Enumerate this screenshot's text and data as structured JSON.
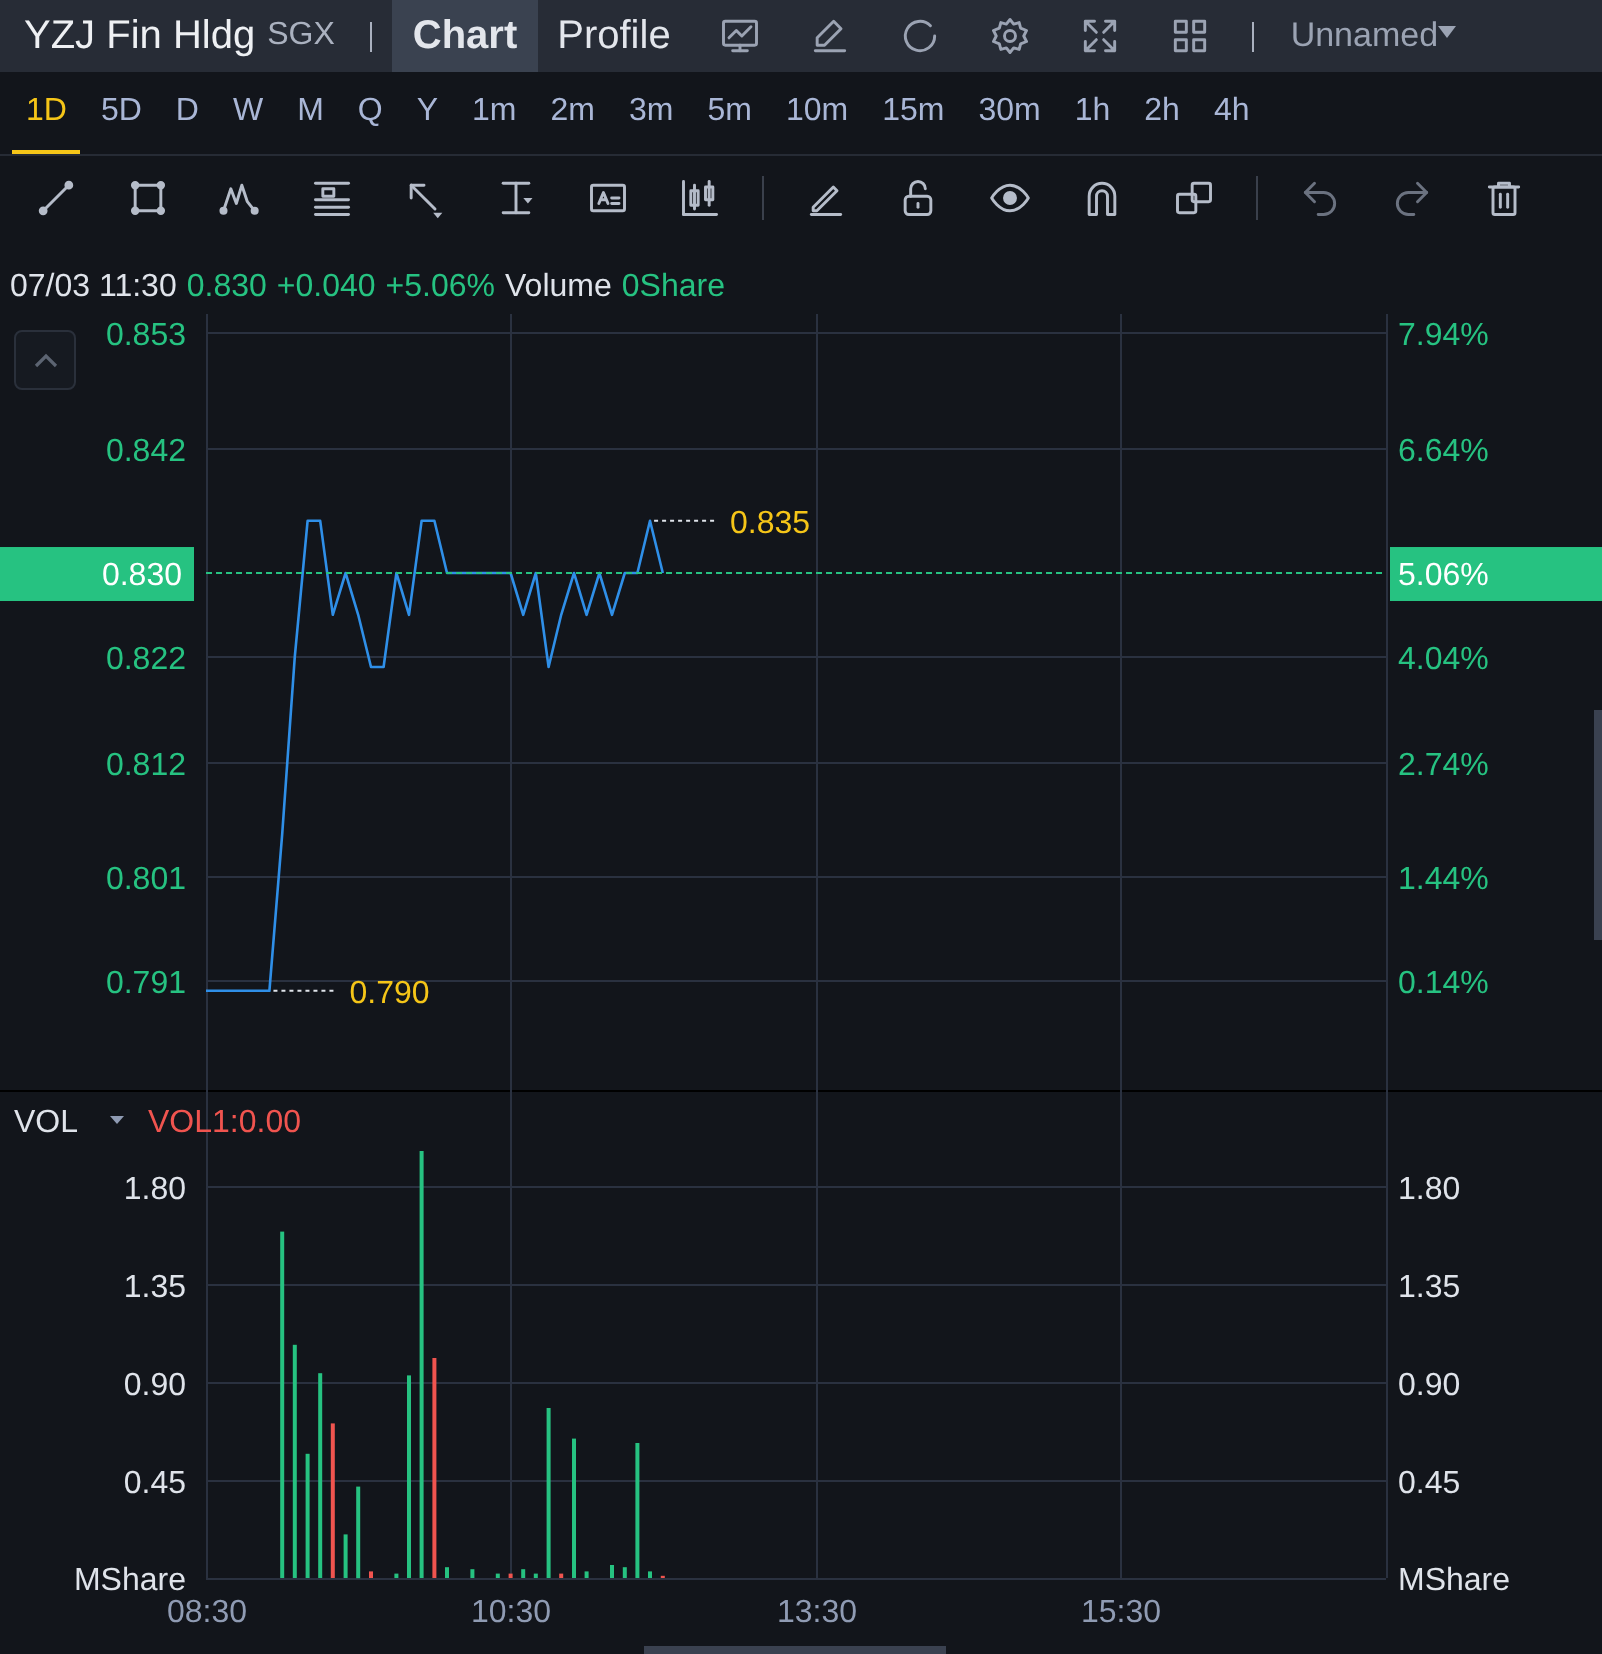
{
  "header": {
    "title": "YZJ Fin Hldg",
    "exchange": "SGX",
    "tabs": [
      {
        "label": "Chart",
        "selected": true
      },
      {
        "label": "Profile",
        "selected": false
      }
    ],
    "layout_menu": "Unnamed"
  },
  "periods": [
    {
      "label": "1D",
      "selected": true
    },
    {
      "label": "5D",
      "selected": false
    },
    {
      "label": "D",
      "selected": false
    },
    {
      "label": "W",
      "selected": false
    },
    {
      "label": "M",
      "selected": false
    },
    {
      "label": "Q",
      "selected": false
    },
    {
      "label": "Y",
      "selected": false
    },
    {
      "label": "1m",
      "selected": false
    },
    {
      "label": "2m",
      "selected": false
    },
    {
      "label": "3m",
      "selected": false
    },
    {
      "label": "5m",
      "selected": false
    },
    {
      "label": "10m",
      "selected": false
    },
    {
      "label": "15m",
      "selected": false
    },
    {
      "label": "30m",
      "selected": false
    },
    {
      "label": "1h",
      "selected": false
    },
    {
      "label": "2h",
      "selected": false
    },
    {
      "label": "4h",
      "selected": false
    }
  ],
  "quote": {
    "time": "07/03 11:30",
    "price": "0.830",
    "change": "+0.040",
    "change_pct": "+5.06%",
    "volume_label": "Volume",
    "volume": "0Share"
  },
  "price_chart": {
    "percent_tag": "5.06%",
    "percent_axis": [
      "7.94%",
      "6.64%",
      "4.04%",
      "2.74%",
      "1.44%",
      "0.14%"
    ],
    "chart_data": {
      "type": "line",
      "categories": [
        null,
        null,
        null,
        null,
        null,
        null,
        null,
        null,
        null,
        null,
        null,
        null,
        null,
        null,
        null,
        null,
        null,
        null,
        null,
        null,
        null,
        null,
        null,
        null,
        null,
        null,
        null,
        null,
        null,
        null,
        null,
        null,
        null,
        null,
        null,
        null,
        null,
        null,
        null,
        null,
        null,
        null,
        null,
        null,
        null,
        null,
        null,
        null,
        null,
        null,
        null,
        null,
        null,
        null,
        null,
        null,
        null,
        null,
        null,
        null,
        null,
        null,
        null,
        null,
        null,
        null,
        null,
        null,
        null,
        null,
        null,
        null,
        null,
        null,
        null,
        null,
        null,
        null,
        null,
        null,
        null,
        null,
        null,
        null,
        null,
        null,
        null,
        null,
        null,
        null,
        null,
        null,
        null,
        null
      ],
      "series": [
        {
          "color": "#2f8fe8",
          "values": [
            0.79,
            0.79,
            0.79,
            0.79,
            0.79,
            0.79,
            0.805,
            0.822,
            0.835,
            0.835,
            0.826,
            0.83,
            0.826,
            0.821,
            0.821,
            0.83,
            0.826,
            0.835,
            0.835,
            0.83,
            0.83,
            0.83,
            0.83,
            0.83,
            0.83,
            0.826,
            0.83,
            0.821,
            0.826,
            0.83,
            0.826,
            0.83,
            0.826,
            0.83,
            0.83,
            0.835,
            0.83,
            null,
            null,
            null,
            null,
            null,
            null,
            null,
            null,
            null,
            null,
            null,
            null,
            null,
            null,
            null,
            null,
            null,
            null,
            null,
            null,
            null,
            null,
            null,
            null,
            null,
            null,
            null,
            null,
            null,
            null,
            null,
            null,
            null,
            null,
            null,
            null,
            null,
            null,
            null,
            null,
            null,
            null,
            null,
            null,
            null,
            null,
            null,
            null,
            null,
            null,
            null,
            null,
            null,
            null,
            null,
            null,
            null
          ]
        }
      ],
      "ylim": [
        0.7805,
        0.8548
      ],
      "grid": true,
      "ref_lines": [
        {
          "axis": "y",
          "value": 0.83,
          "label": "0.830"
        }
      ],
      "yticks": [
        {
          "value": 0.853,
          "label": "0.853"
        },
        {
          "value": 0.842,
          "label": "0.842"
        },
        {
          "value": 0.822,
          "label": "0.822"
        },
        {
          "value": 0.812,
          "label": "0.812"
        },
        {
          "value": 0.801,
          "label": "0.801"
        },
        {
          "value": 0.791,
          "label": "0.791"
        }
      ],
      "annotations": [
        "0.835",
        "0.790"
      ]
    }
  },
  "volume_chart": {
    "indicator": "VOL",
    "indicator_value": "VOL1:0.00",
    "right_axis": [
      "1.80",
      "1.35",
      "0.90",
      "0.45"
    ],
    "right_unit": "MShare",
    "chart_data": {
      "type": "bar",
      "ylabel": "MShare",
      "categories": [
        "08:30",
        null,
        null,
        null,
        null,
        null,
        null,
        null,
        null,
        null,
        null,
        null,
        null,
        null,
        null,
        null,
        null,
        null,
        null,
        null,
        null,
        null,
        null,
        null,
        "10:30",
        null,
        null,
        null,
        null,
        null,
        null,
        null,
        null,
        null,
        null,
        null,
        null,
        null,
        null,
        null,
        null,
        null,
        null,
        null,
        null,
        null,
        null,
        null,
        "13:30",
        null,
        null,
        null,
        null,
        null,
        null,
        null,
        null,
        null,
        null,
        null,
        null,
        null,
        null,
        null,
        null,
        null,
        null,
        null,
        null,
        null,
        null,
        null,
        "15:30",
        null,
        null,
        null,
        null,
        null,
        null,
        null,
        null,
        null,
        null,
        null,
        null,
        null,
        null,
        null,
        null,
        null,
        null,
        null,
        null,
        null
      ],
      "series": [
        {
          "color": "#26c281",
          "values": [
            null,
            null,
            null,
            null,
            null,
            null,
            1.59,
            1.07,
            0.57,
            0.94,
            null,
            0.2,
            0.42,
            null,
            null,
            0.02,
            0.93,
            1.96,
            null,
            0.05,
            null,
            0.04,
            null,
            0.02,
            null,
            0.04,
            0.02,
            0.78,
            null,
            0.64,
            0.03,
            null,
            0.06,
            0.05,
            0.62,
            0.03,
            null,
            null,
            null,
            null,
            null,
            null,
            null,
            null,
            null,
            null,
            null,
            null,
            null,
            null,
            null,
            null,
            null,
            null,
            null,
            null,
            null,
            null,
            null,
            null,
            null,
            null,
            null,
            null,
            null,
            null,
            null,
            null,
            null,
            null,
            null,
            null,
            null,
            null,
            null,
            null,
            null,
            null,
            null,
            null,
            null,
            null,
            null,
            null,
            null,
            null,
            null,
            null,
            null,
            null,
            null,
            null,
            null,
            null
          ]
        },
        {
          "color": "#f0544f",
          "values": [
            null,
            null,
            null,
            null,
            null,
            null,
            null,
            null,
            null,
            null,
            0.71,
            null,
            null,
            0.03,
            null,
            null,
            null,
            null,
            1.01,
            null,
            null,
            null,
            null,
            null,
            0.02,
            null,
            null,
            null,
            0.02,
            null,
            null,
            null,
            null,
            null,
            null,
            null,
            0.01,
            null,
            null,
            null,
            null,
            null,
            null,
            null,
            null,
            null,
            null,
            null,
            null,
            null,
            null,
            null,
            null,
            null,
            null,
            null,
            null,
            null,
            null,
            null,
            null,
            null,
            null,
            null,
            null,
            null,
            null,
            null,
            null,
            null,
            null,
            null,
            null,
            null,
            null,
            null,
            null,
            null,
            null,
            null,
            null,
            null,
            null,
            null,
            null,
            null,
            null,
            null,
            null,
            null,
            null,
            null,
            null,
            null
          ]
        }
      ],
      "ylim": [
        0,
        2.24
      ],
      "grid": true,
      "yticks": [
        {
          "value": 1.8,
          "label": "1.80"
        },
        {
          "value": 1.35,
          "label": "1.35"
        },
        {
          "value": 0.9,
          "label": "0.90"
        },
        {
          "value": 0.45,
          "label": "0.45"
        }
      ]
    }
  }
}
